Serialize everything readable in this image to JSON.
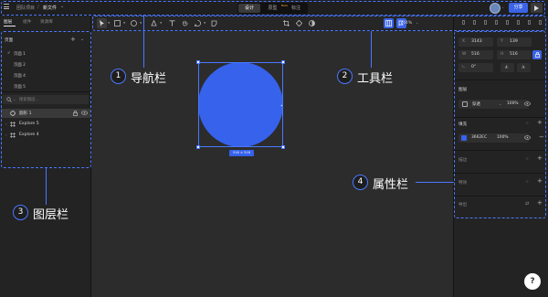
{
  "topbar": {
    "team_label": "团队项目",
    "separator": "/",
    "file_label": "新文件",
    "modes": [
      {
        "label": "设计",
        "active": true
      },
      {
        "label": "原型",
        "active": false,
        "badge": "Beta"
      },
      {
        "label": "标注",
        "active": false
      }
    ],
    "share_label": "分享"
  },
  "left_panel": {
    "tabs": [
      {
        "label": "图层",
        "active": true
      },
      {
        "label": "组件",
        "active": false
      },
      {
        "label": "资源库",
        "active": false
      }
    ],
    "pages_title": "页面",
    "pages": [
      {
        "label": "页面 1",
        "current": true
      },
      {
        "label": "页面 2",
        "current": false
      },
      {
        "label": "页面 4",
        "current": false
      },
      {
        "label": "页面 5",
        "current": false
      }
    ],
    "search_placeholder": "搜索图层...",
    "layers": [
      {
        "name": "圆形 1",
        "selected": true,
        "icon": "ellipse-icon"
      },
      {
        "name": "Explore 5",
        "selected": false,
        "icon": "frame-icon"
      },
      {
        "name": "Explore 4",
        "selected": false,
        "icon": "frame-icon"
      }
    ]
  },
  "toolbar": {
    "tools": [
      "move-tool",
      "frame-tool",
      "shape-tool",
      "pen-tool",
      "text-tool",
      "hand-tool",
      "comment-tool",
      "component-tool"
    ],
    "zoom": "44%"
  },
  "canvas": {
    "shape_color": "#3662EC",
    "size_tag": "516 × 516"
  },
  "right_panel": {
    "fields": {
      "x_label": "X",
      "x_value": "3143",
      "y_label": "Y",
      "y_value": "139",
      "w_label": "W",
      "w_value": "516",
      "h_label": "H",
      "h_value": "516",
      "r_value": "0°"
    },
    "layer_section": "图层",
    "blend_mode": "穿透",
    "layer_opacity": "100%",
    "fill_section": "填充",
    "fill_hex": "3662EC",
    "fill_opacity": "100%",
    "stroke_section": "描边",
    "effect_section": "特效",
    "export_section": "导出"
  },
  "annotations": [
    {
      "num": "1",
      "label": "导航栏"
    },
    {
      "num": "2",
      "label": "工具栏"
    },
    {
      "num": "3",
      "label": "图层栏"
    },
    {
      "num": "4",
      "label": "属性栏"
    }
  ],
  "help_label": "?"
}
